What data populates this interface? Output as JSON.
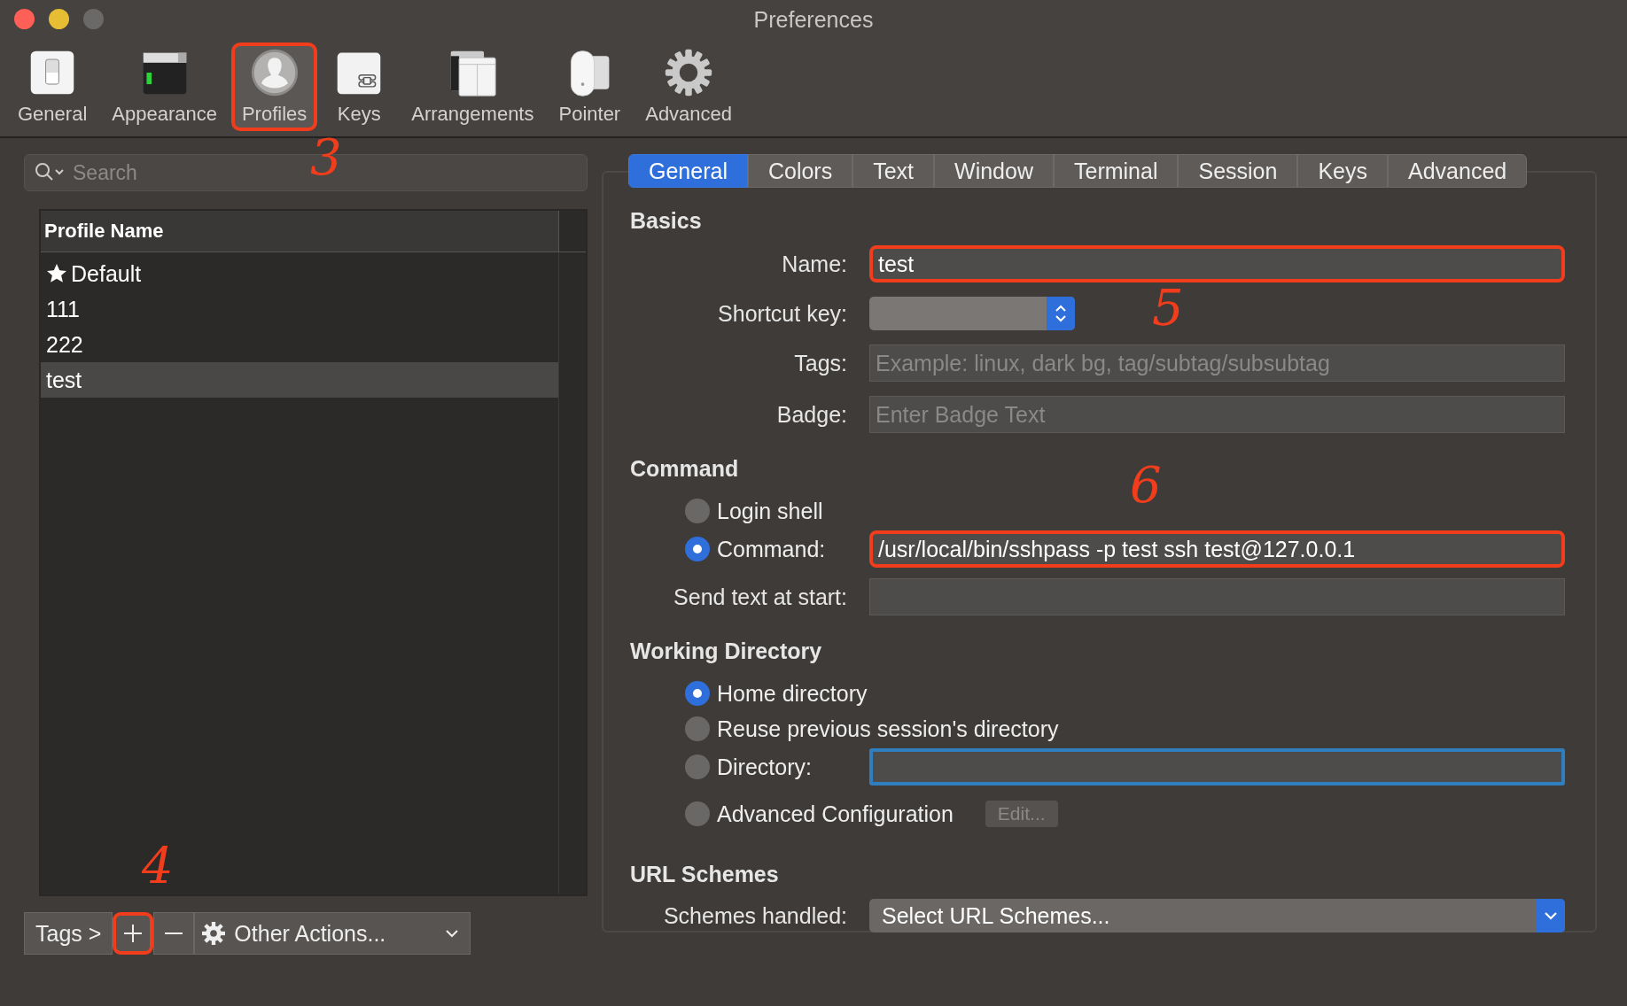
{
  "window": {
    "title": "Preferences"
  },
  "toolbar": [
    {
      "label": "General",
      "selected": false,
      "highlighted": false
    },
    {
      "label": "Appearance",
      "selected": false,
      "highlighted": false
    },
    {
      "label": "Profiles",
      "selected": true,
      "highlighted": true
    },
    {
      "label": "Keys",
      "selected": false,
      "highlighted": false
    },
    {
      "label": "Arrangements",
      "selected": false,
      "highlighted": false
    },
    {
      "label": "Pointer",
      "selected": false,
      "highlighted": false
    },
    {
      "label": "Advanced",
      "selected": false,
      "highlighted": false
    }
  ],
  "sidebar": {
    "search": {
      "placeholder": "Search"
    },
    "table": {
      "columns": [
        "Profile Name"
      ],
      "rows": [
        {
          "name": "Default",
          "starred": true,
          "selected": false
        },
        {
          "name": "111",
          "starred": false,
          "selected": false
        },
        {
          "name": "222",
          "starred": false,
          "selected": false
        },
        {
          "name": "test",
          "starred": false,
          "selected": true
        }
      ]
    },
    "bottom_bar": {
      "tags": "Tags >",
      "add_highlighted": true,
      "other_actions": "Other Actions..."
    }
  },
  "tabs": [
    {
      "label": "General",
      "selected": true
    },
    {
      "label": "Colors",
      "selected": false
    },
    {
      "label": "Text",
      "selected": false
    },
    {
      "label": "Window",
      "selected": false
    },
    {
      "label": "Terminal",
      "selected": false
    },
    {
      "label": "Session",
      "selected": false
    },
    {
      "label": "Keys",
      "selected": false
    },
    {
      "label": "Advanced",
      "selected": false
    }
  ],
  "basics": {
    "heading": "Basics",
    "name": {
      "label": "Name:",
      "value": "test",
      "highlighted": true
    },
    "shortcut_key": {
      "label": "Shortcut key:"
    },
    "tags": {
      "label": "Tags:",
      "placeholder": "Example: linux, dark bg, tag/subtag/subsubtag"
    },
    "badge": {
      "label": "Badge:",
      "placeholder": "Enter Badge Text"
    }
  },
  "command": {
    "heading": "Command",
    "options": [
      {
        "label": "Login shell",
        "kind": "plain",
        "selected": false
      },
      {
        "label": "Command:",
        "kind": "field",
        "selected": true,
        "value": "/usr/local/bin/sshpass -p test ssh test@127.0.0.1",
        "highlighted": true,
        "focused": false
      }
    ],
    "send_text": {
      "label": "Send text at start:"
    }
  },
  "working_directory": {
    "heading": "Working Directory",
    "options": [
      {
        "label": "Home directory",
        "kind": "plain",
        "selected": true
      },
      {
        "label": "Reuse previous session's directory",
        "kind": "plain",
        "selected": false
      },
      {
        "label": "Directory:",
        "kind": "field",
        "selected": false,
        "focused": true
      },
      {
        "label": "Advanced Configuration",
        "kind": "button",
        "selected": false,
        "button": "Edit...",
        "disabled": true
      }
    ]
  },
  "url_schemes": {
    "heading": "URL Schemes",
    "label": "Schemes handled:",
    "value": "Select URL Schemes..."
  },
  "annotations": [
    {
      "label": "3"
    },
    {
      "label": "4"
    },
    {
      "label": "5"
    },
    {
      "label": "6"
    }
  ]
}
